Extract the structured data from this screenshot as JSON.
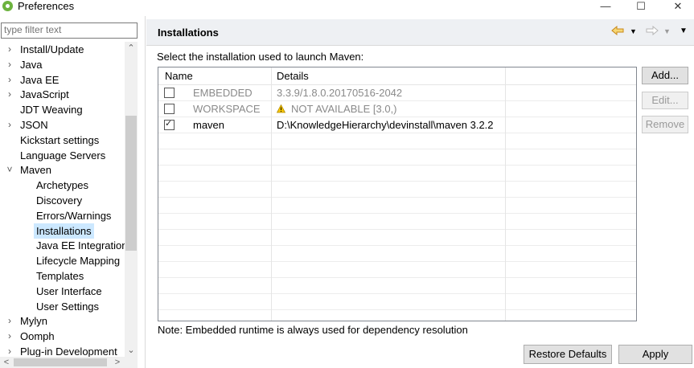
{
  "window": {
    "title": "Preferences",
    "minimize": "—",
    "maximize": "☐",
    "close": "✕"
  },
  "filter": {
    "placeholder": "type filter text"
  },
  "tree": {
    "items": [
      {
        "label": "Install/Update",
        "arrow": ">",
        "indent": 0
      },
      {
        "label": "Java",
        "arrow": ">",
        "indent": 0
      },
      {
        "label": "Java EE",
        "arrow": ">",
        "indent": 0
      },
      {
        "label": "JavaScript",
        "arrow": ">",
        "indent": 0
      },
      {
        "label": "JDT Weaving",
        "arrow": "",
        "indent": 0
      },
      {
        "label": "JSON",
        "arrow": ">",
        "indent": 0
      },
      {
        "label": "Kickstart settings",
        "arrow": "",
        "indent": 0
      },
      {
        "label": "Language Servers",
        "arrow": "",
        "indent": 0
      },
      {
        "label": "Maven",
        "arrow": "v",
        "indent": 0
      },
      {
        "label": "Archetypes",
        "arrow": "",
        "indent": 1
      },
      {
        "label": "Discovery",
        "arrow": "",
        "indent": 1
      },
      {
        "label": "Errors/Warnings",
        "arrow": "",
        "indent": 1
      },
      {
        "label": "Installations",
        "arrow": "",
        "indent": 1,
        "selected": true
      },
      {
        "label": "Java EE Integration",
        "arrow": "",
        "indent": 1
      },
      {
        "label": "Lifecycle Mapping",
        "arrow": "",
        "indent": 1
      },
      {
        "label": "Templates",
        "arrow": "",
        "indent": 1
      },
      {
        "label": "User Interface",
        "arrow": "",
        "indent": 1
      },
      {
        "label": "User Settings",
        "arrow": "",
        "indent": 1
      },
      {
        "label": "Mylyn",
        "arrow": ">",
        "indent": 0
      },
      {
        "label": "Oomph",
        "arrow": ">",
        "indent": 0
      },
      {
        "label": "Plug-in Development",
        "arrow": ">",
        "indent": 0
      }
    ]
  },
  "header": {
    "title": "Installations"
  },
  "main": {
    "description": "Select the installation used to launch Maven:",
    "columns": {
      "name": "Name",
      "details": "Details"
    },
    "rows": [
      {
        "name": "EMBEDDED",
        "details": "3.3.9/1.8.0.20170516-2042",
        "checked": false,
        "disabled": true,
        "warning": false
      },
      {
        "name": "WORKSPACE",
        "details": "NOT AVAILABLE [3.0,)",
        "checked": false,
        "disabled": true,
        "warning": true
      },
      {
        "name": "maven",
        "details": "D:\\KnowledgeHierarchy\\devinstall\\maven 3.2.2",
        "checked": true,
        "disabled": false,
        "warning": false
      }
    ],
    "buttons": {
      "add": "Add...",
      "edit": "Edit...",
      "remove": "Remove"
    },
    "note": "Note: Embedded runtime is always used for dependency resolution"
  },
  "footer": {
    "restore": "Restore Defaults",
    "apply": "Apply"
  },
  "colors": {
    "selection": "#cce8ff",
    "header_bg": "#eef0f3",
    "nav_arrow": "#e8a317",
    "disabled_text": "#8a8a8a"
  }
}
